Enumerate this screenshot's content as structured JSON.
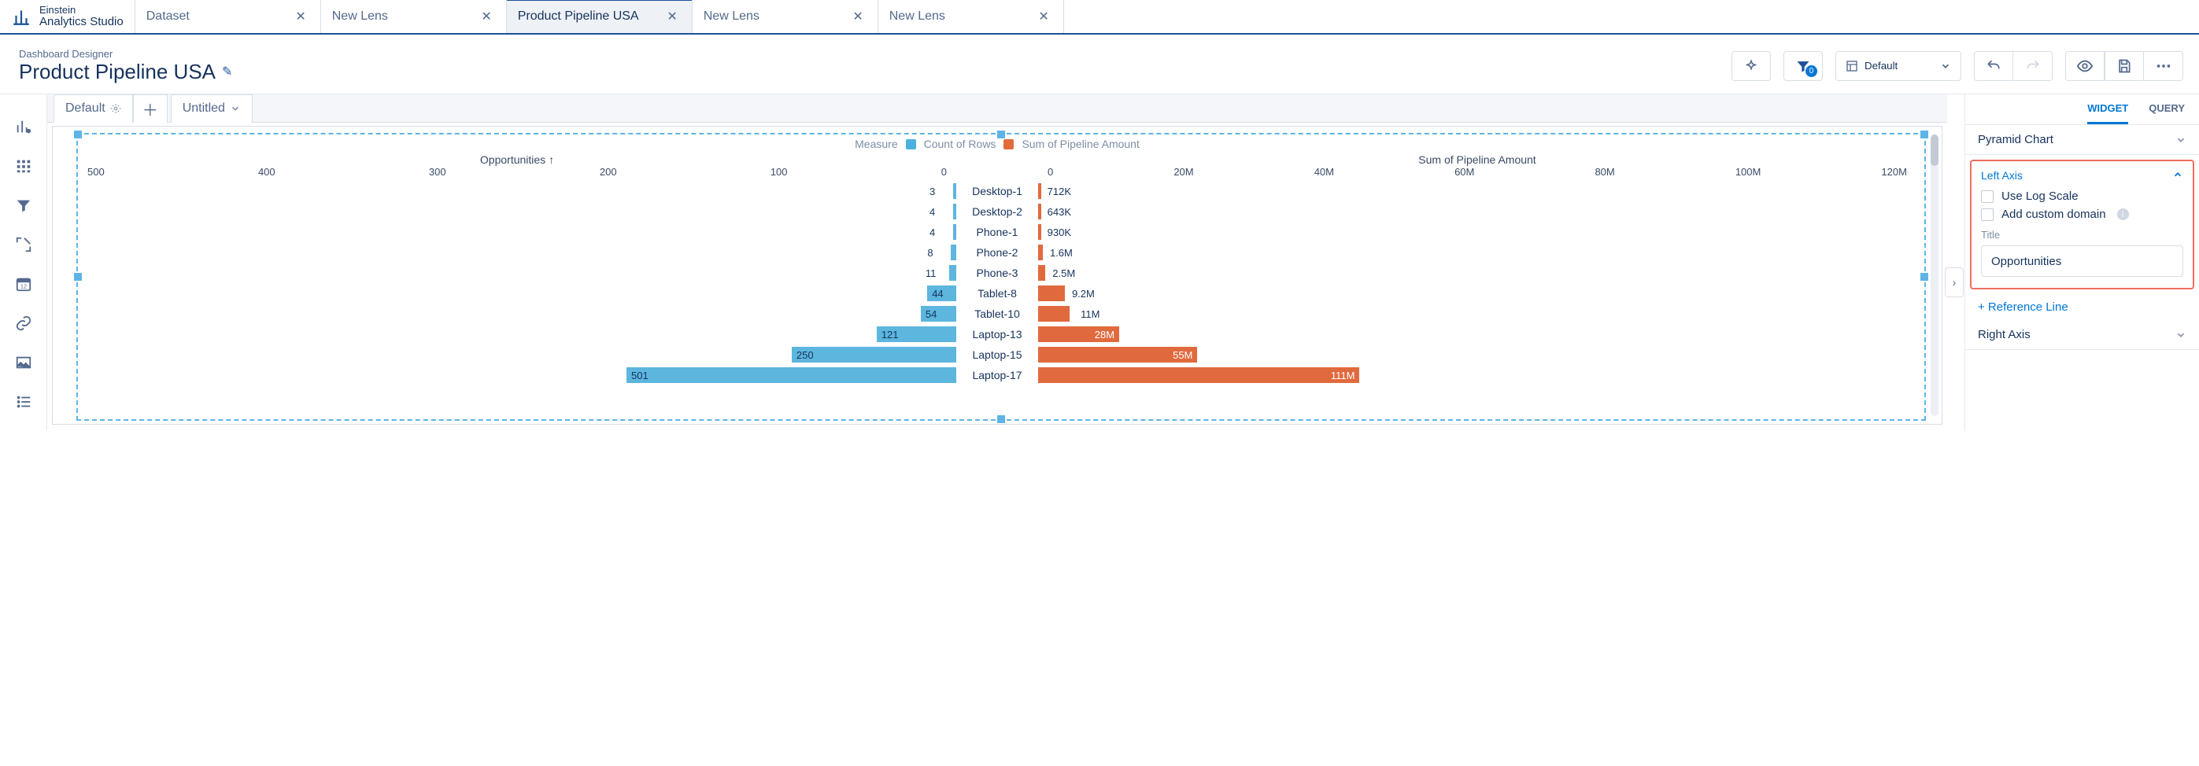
{
  "brand": {
    "line1": "Einstein",
    "line2": "Analytics Studio"
  },
  "tabs": [
    {
      "label": "Dataset"
    },
    {
      "label": "New Lens"
    },
    {
      "label": "Product Pipeline USA",
      "active": true
    },
    {
      "label": "New Lens"
    },
    {
      "label": "New Lens"
    }
  ],
  "header": {
    "breadcrumb": "Dashboard Designer",
    "title": "Product Pipeline USA",
    "filter_badge": "0",
    "layout_label": "Default"
  },
  "page_tabs": {
    "default": "Default",
    "untitled": "Untitled"
  },
  "right_panel": {
    "tab_widget": "WIDGET",
    "tab_query": "QUERY",
    "pyramid": "Pyramid Chart",
    "left_axis": "Left Axis",
    "log_scale": "Use Log Scale",
    "custom_domain": "Add custom domain",
    "title_label": "Title",
    "title_value": "Opportunities",
    "ref_line": "+ Reference Line",
    "right_axis": "Right Axis"
  },
  "chart_data": {
    "type": "bar",
    "title_measure": "Measure",
    "series": [
      {
        "name": "Count of Rows",
        "color": "#5cb6de"
      },
      {
        "name": "Sum of Pipeline Amount",
        "color": "#e06a3e"
      }
    ],
    "axis_left": {
      "label": "Opportunities ↑",
      "ticks": [
        "500",
        "400",
        "300",
        "200",
        "100",
        "0"
      ],
      "max": 550
    },
    "axis_right": {
      "label": "Sum of Pipeline Amount",
      "ticks": [
        "0",
        "20M",
        "40M",
        "60M",
        "80M",
        "100M",
        "120M"
      ],
      "max": 125
    },
    "categories": [
      "Desktop-1",
      "Desktop-2",
      "Phone-1",
      "Phone-2",
      "Phone-3",
      "Tablet-8",
      "Tablet-10",
      "Laptop-13",
      "Laptop-15",
      "Laptop-17"
    ],
    "left_values": [
      3,
      4,
      4,
      8,
      11,
      44,
      54,
      121,
      250,
      501
    ],
    "left_labels": [
      "3",
      "4",
      "4",
      "8",
      "11",
      "44",
      "54",
      "121",
      "250",
      "501"
    ],
    "right_values_m": [
      0.712,
      0.643,
      0.93,
      1.6,
      2.5,
      9.2,
      11,
      28,
      55,
      111
    ],
    "right_labels": [
      "712K",
      "643K",
      "930K",
      "1.6M",
      "2.5M",
      "9.2M",
      "11M",
      "28M",
      "55M",
      "111M"
    ]
  }
}
